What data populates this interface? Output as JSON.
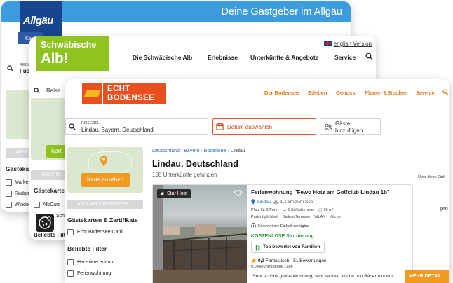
{
  "allgaeu": {
    "logo_text": "Allgäu",
    "banner": "Deine Gastgeber im Allgäu",
    "search_label": "REISEZ",
    "search_value": "Füss",
    "map_button": "Ka",
    "filter_button": "Alle Filt",
    "filter_heading": "Gästekarten",
    "options": [
      "Marken",
      "Radgas",
      "Winde"
    ]
  },
  "alb": {
    "logo_line1": "Schwäbische",
    "logo_line2": "Alb!",
    "language": "english Version",
    "nav": [
      "Die Schwäbische Alb",
      "Erlebnisse",
      "Unterkünfte & Angebote",
      "Service"
    ],
    "search_value": "Reise",
    "map_button": "Kart",
    "filter_button": "Alle Filte",
    "filter_heading": "Gästekarten",
    "options": [
      "AlbCard",
      "Schwäb"
    ],
    "heading2": "Beliebte Filte"
  },
  "bodensee": {
    "logo_line1": "ECHT",
    "logo_line2": "BODENSEE",
    "nav": [
      "Der Bodensee",
      "Erleben",
      "Genuss",
      "Planen & Buchen",
      "Service"
    ],
    "search_label": "REISEZIEL",
    "search_value": "Lindau, Bayern, Deutschland",
    "date_value": "Datum auswählen",
    "guests_value_line1": "Gäste",
    "guests_value_line2": "hinzufügen",
    "map_button": "Karte ansehen",
    "filter_button": "Alle Filter zurücksetzen",
    "filter_heading": "Gästekarten & Zertifikate",
    "filter_options": [
      "Echt Bodensee Card"
    ],
    "popular_heading": "Beliebte Filter",
    "popular_options": [
      "Haustiere erlaubt",
      "Ferienwohnung"
    ],
    "breadcrumb": [
      "Deutschland",
      "Bayern",
      "Bodensee",
      "Lindau"
    ],
    "title": "Lindau, Deutschland",
    "result_count": "158 Unterkünfte gefunden",
    "side_label": "Über diese Einh",
    "side_label2": "pro",
    "listing": {
      "badge": "Star Host",
      "title": "Ferienwohnung \"Fewo Hotz am Golfclub Lindau 1b\"",
      "city": "Lindau",
      "distance": "1,1 km zum See",
      "facts_row1": [
        "Platz für 2 Pers.",
        "1 Schlafzimmer",
        "98 m²"
      ],
      "facts_row2": [
        "Parkmöglichkeit",
        "Balkon/Terrasse",
        "WLAN",
        "Küche"
      ],
      "more_units": "Eine weitere Einheit verfügbar",
      "cancellation": "KOSTENLOSE Stornierung",
      "family_badge": "Top bewertet von Familien",
      "rating_score": "9,3",
      "rating_word": "Fantastisch",
      "rating_count": "· 51 Bewertungen",
      "location_rating": "9,0 Hervorragende Lage",
      "quote": "\"Sehr schöne große Wohnung, sehr sauber, Küche und Bäder modern",
      "cta": "MEHR DETAIL"
    }
  }
}
